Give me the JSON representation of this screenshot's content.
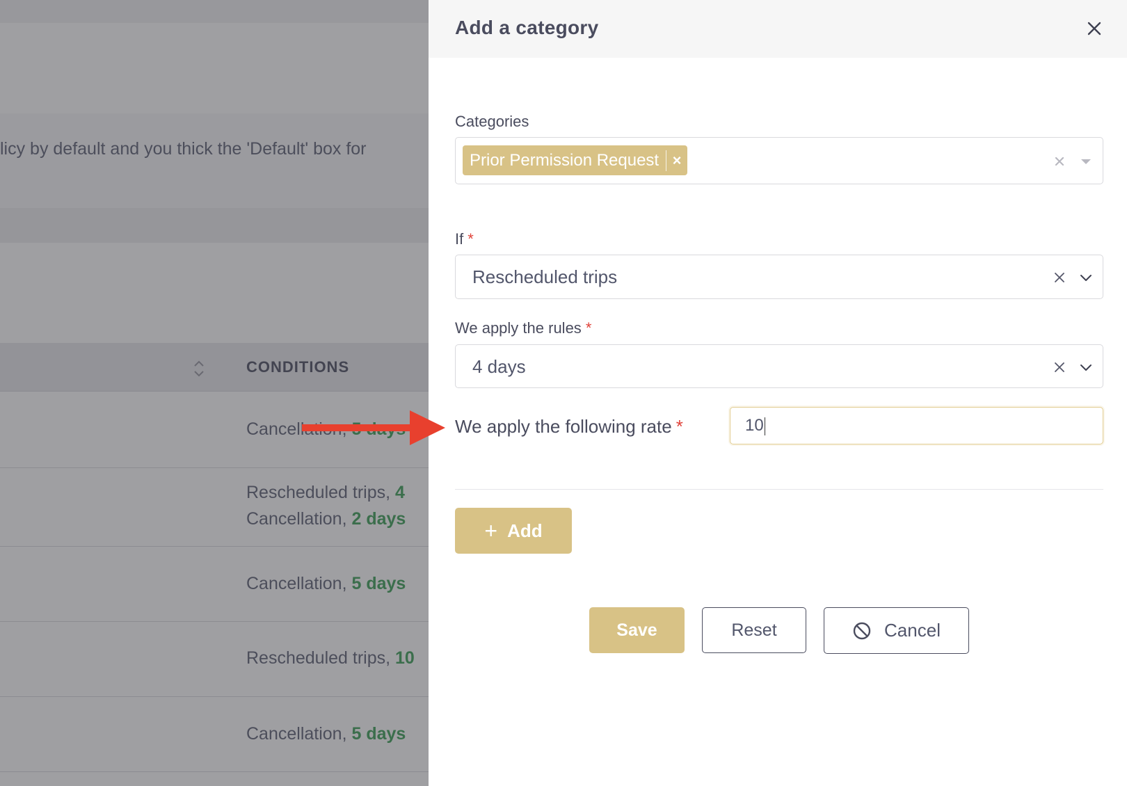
{
  "background": {
    "notice_text": "licy by default and you thick the 'Default' box for",
    "table": {
      "conditions_header": "CONDITIONS",
      "rows": [
        {
          "line1_text": "Cancellation, ",
          "line1_green": "5 days",
          "line2_text": "",
          "line2_green": ""
        },
        {
          "line1_text": "Rescheduled trips, ",
          "line1_green": "4",
          "line2_text": "Cancellation, ",
          "line2_green": "2 days"
        },
        {
          "line1_text": "Cancellation, ",
          "line1_green": "5 days",
          "line2_text": "",
          "line2_green": ""
        },
        {
          "line1_text": "Rescheduled trips, ",
          "line1_green": "10",
          "line2_text": "",
          "line2_green": ""
        },
        {
          "line1_text": "Cancellation, ",
          "line1_green": "5 days",
          "line2_text": "",
          "line2_green": ""
        }
      ]
    }
  },
  "drawer": {
    "title": "Add a category",
    "categories": {
      "label": "Categories",
      "selected_tag": "Prior Permission Request"
    },
    "if_field": {
      "label": "If",
      "required_mark": "*",
      "value": "Rescheduled trips"
    },
    "rules_field": {
      "label": "We apply the rules",
      "required_mark": "*",
      "value": "4 days"
    },
    "rate_field": {
      "label": "We apply the following rate",
      "required_mark": "*",
      "value": "10"
    },
    "add_button": {
      "icon": "plus-icon",
      "label": "Add"
    },
    "save_button": "Save",
    "reset_button": "Reset",
    "cancel_button": {
      "icon": "ban-icon",
      "label": "Cancel"
    }
  },
  "colors": {
    "accent_gold": "#d8c286",
    "required_red": "#e0433a",
    "condition_green": "#2f9a4c",
    "annotation_arrow": "#e8402e"
  }
}
